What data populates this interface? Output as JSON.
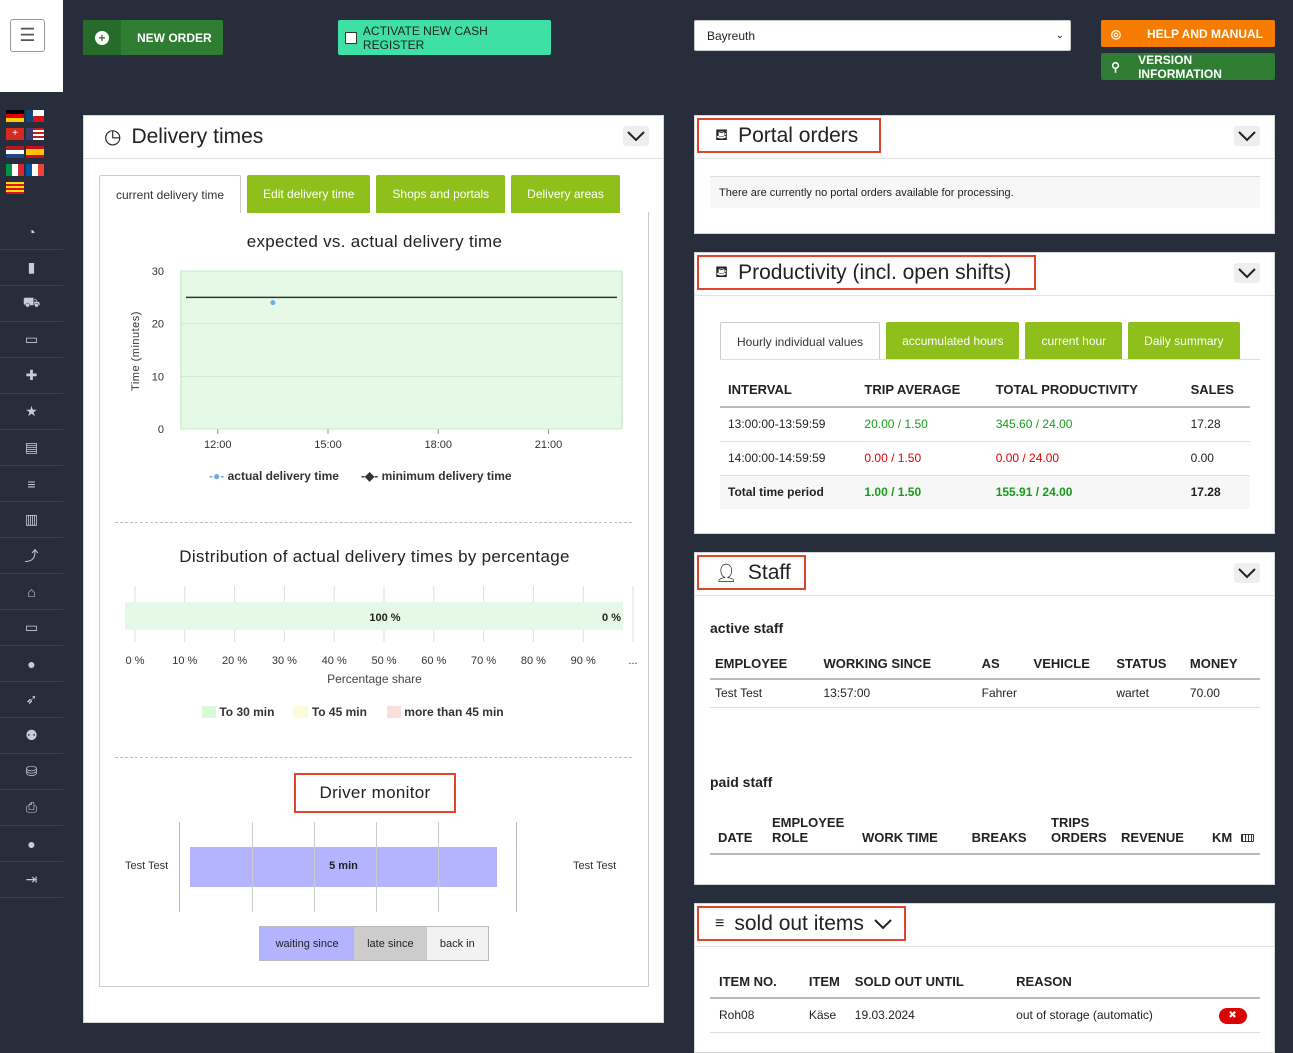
{
  "toolbar": {
    "new_order": "NEW ORDER",
    "activate_register": "ACTIVATE NEW CASH REGISTER",
    "location": "Bayreuth",
    "help": "HELP AND MANUAL",
    "version": "VERSION INFORMATION"
  },
  "delivery": {
    "title": "Delivery times",
    "tabs": [
      "current delivery time",
      "Edit delivery time",
      "Shops and portals",
      "Delivery areas"
    ]
  },
  "chart_data": [
    {
      "type": "line",
      "title": "expected vs. actual delivery time",
      "ylabel": "Time (minutes)",
      "xlabel": "",
      "ylim": [
        0,
        30
      ],
      "yticks": [
        "0",
        "10",
        "20",
        "30"
      ],
      "xticks": [
        "12:00",
        "15:00",
        "18:00",
        "21:00"
      ],
      "series": [
        {
          "name": "actual delivery time",
          "x": [
            "13:30"
          ],
          "values": [
            24
          ]
        },
        {
          "name": "minimum delivery time",
          "x": [
            "11:00",
            "22:59"
          ],
          "values": [
            25,
            25
          ]
        }
      ]
    },
    {
      "type": "bar",
      "title": "Distribution of actual delivery times by percentage",
      "xlabel": "Percentage share",
      "xticks": [
        "0 %",
        "10 %",
        "20 %",
        "30 %",
        "40 %",
        "50 %",
        "60 %",
        "70 %",
        "80 %",
        "90 %",
        "..."
      ],
      "series": [
        {
          "name": "To 30 min",
          "values": [
            100
          ]
        },
        {
          "name": "To 45 min",
          "values": [
            0
          ]
        },
        {
          "name": "more than 45 min",
          "values": [
            0
          ]
        }
      ],
      "data_labels": [
        "100 %",
        "0 %"
      ]
    },
    {
      "type": "bar",
      "title": "Driver monitor",
      "categories": [
        "Test Test"
      ],
      "series": [
        {
          "name": "waiting since",
          "values": [
            5
          ]
        }
      ],
      "data_labels": [
        "5 min"
      ]
    }
  ],
  "legend1": {
    "actual": "actual delivery time",
    "minimum": "minimum delivery time"
  },
  "legend2": {
    "a": "To 30 min",
    "b": "To 45 min",
    "c": "more than 45 min"
  },
  "driver": {
    "name": "Test Test",
    "bar": "5 min",
    "buttons": [
      "waiting since",
      "late since",
      "back in"
    ]
  },
  "portal": {
    "title": "Portal orders",
    "empty": "There are currently no portal orders available for processing."
  },
  "productivity": {
    "title": "Productivity (incl. open shifts)",
    "tabs": [
      "Hourly individual values",
      "accumulated hours",
      "current hour",
      "Daily summary"
    ],
    "headers": [
      "INTERVAL",
      "TRIP AVERAGE",
      "TOTAL PRODUCTIVITY",
      "SALES"
    ],
    "rows": [
      [
        "13:00:00-13:59:59",
        "20.00 / 1.50",
        "345.60 / 24.00",
        "17.28"
      ],
      [
        "14:00:00-14:59:59",
        "0.00 / 1.50",
        "0.00 / 24.00",
        "0.00"
      ],
      [
        "Total time period",
        "1.00 / 1.50",
        "155.91 / 24.00",
        "17.28"
      ]
    ]
  },
  "staff": {
    "title": "Staff",
    "active": "active staff",
    "headers": [
      "EMPLOYEE",
      "WORKING SINCE",
      "AS",
      "VEHICLE",
      "STATUS",
      "MONEY"
    ],
    "rows": [
      [
        "Test Test",
        "13:57:00",
        "Fahrer",
        "",
        "wartet",
        "70.00"
      ]
    ],
    "paid": "paid staff",
    "paid_headers": [
      "DATE",
      "EMPLOYEE ROLE",
      "WORK TIME",
      "BREAKS",
      "TRIPS ORDERS",
      "REVENUE",
      "KM"
    ]
  },
  "sold": {
    "title": "sold out items",
    "headers": [
      "ITEM NO.",
      "ITEM",
      "SOLD OUT UNTIL",
      "REASON"
    ],
    "rows": [
      [
        "Roh08",
        "Käse",
        "19.03.2024",
        "out of storage (automatic)"
      ]
    ]
  }
}
